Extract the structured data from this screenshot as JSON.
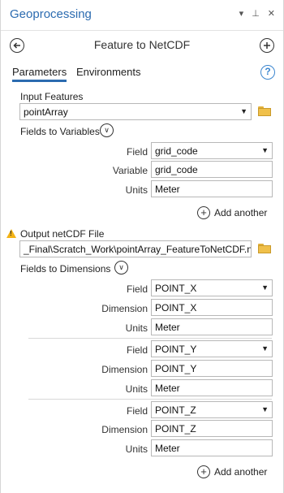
{
  "pane": {
    "title": "Geoprocessing",
    "controls": {
      "menu": "▾",
      "pin": "⊥",
      "close": "✕"
    }
  },
  "tool": {
    "title": "Feature to NetCDF",
    "back_icon": "back-arrow-icon",
    "add_icon": "plus-icon"
  },
  "tabs": [
    {
      "label": "Parameters",
      "active": true
    },
    {
      "label": "Environments",
      "active": false
    }
  ],
  "help_icon": "?",
  "input_features": {
    "label": "Input Features",
    "value": "pointArray"
  },
  "fields_to_variables": {
    "label": "Fields to Variables",
    "rows": [
      {
        "field_label": "Field",
        "field_value": "grid_code",
        "var_label": "Variable",
        "var_value": "grid_code",
        "units_label": "Units",
        "units_value": "Meter"
      }
    ],
    "add_another": "Add another"
  },
  "output_file": {
    "label": "Output netCDF File",
    "value": "_Final\\Scratch_Work\\pointArray_FeatureToNetCDF.nc"
  },
  "fields_to_dimensions": {
    "label": "Fields to Dimensions",
    "rows": [
      {
        "field_label": "Field",
        "field_value": "POINT_X",
        "dim_label": "Dimension",
        "dim_value": "POINT_X",
        "units_label": "Units",
        "units_value": "Meter"
      },
      {
        "field_label": "Field",
        "field_value": "POINT_Y",
        "dim_label": "Dimension",
        "dim_value": "POINT_Y",
        "units_label": "Units",
        "units_value": "Meter"
      },
      {
        "field_label": "Field",
        "field_value": "POINT_Z",
        "dim_label": "Dimension",
        "dim_value": "POINT_Z",
        "units_label": "Units",
        "units_value": "Meter"
      }
    ],
    "add_another": "Add another"
  },
  "colors": {
    "accent": "#2b6bb0",
    "warning": "#f3b316",
    "folder": "#f0c04a"
  }
}
